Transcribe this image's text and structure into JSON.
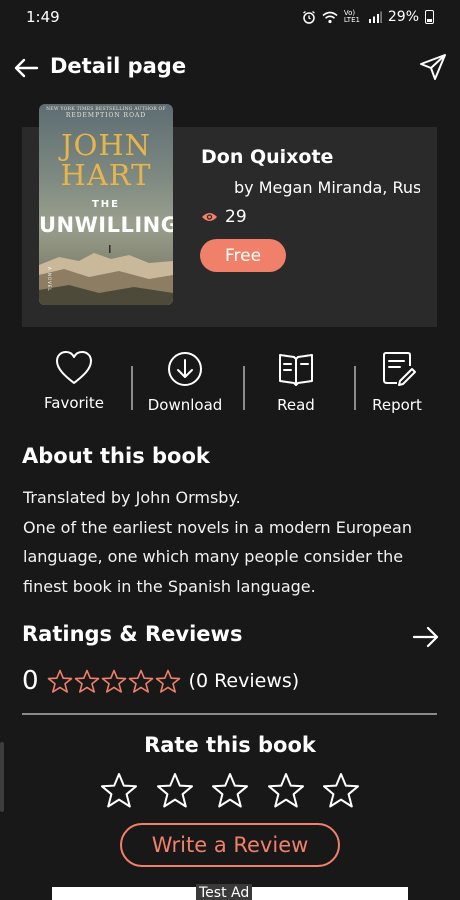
{
  "status_bar": {
    "time": "1:49",
    "network_label": "Vo) LTE1",
    "battery": "29%"
  },
  "header": {
    "title": "Detail page",
    "back_icon": "arrow-left-icon",
    "share_icon": "send-icon"
  },
  "book": {
    "cover": {
      "top_text": "NEW YORK TIMES BESTSELLING AUTHOR OF",
      "top_text_2": "REDEMPTION ROAD",
      "author_line_1": "JOHN",
      "author_line_2": "HART",
      "the": "THE",
      "title": "UNWILLING",
      "novel": "A NOVEL"
    },
    "title": "Don Quixote",
    "author": "by Megan Miranda, Rus",
    "views": "29",
    "price_label": "Free"
  },
  "actions": [
    {
      "label": "Favorite",
      "icon": "heart-icon"
    },
    {
      "label": "Download",
      "icon": "download-icon"
    },
    {
      "label": "Read",
      "icon": "book-open-icon"
    },
    {
      "label": "Report",
      "icon": "report-icon"
    }
  ],
  "about": {
    "title": "About this book",
    "lines": [
      "Translated by John Ormsby.",
      "One of the earliest novels in a modern European",
      "language, one which many people consider the",
      "finest book in the Spanish language."
    ]
  },
  "ratings": {
    "title": "Ratings & Reviews",
    "value": "0",
    "stars_filled": 0,
    "stars_total": 5,
    "review_count": "(0 Reviews)"
  },
  "rate": {
    "title": "Rate this book",
    "stars_total": 5,
    "write_review_label": "Write a Review"
  },
  "ad": {
    "label": "Test Ad"
  },
  "colors": {
    "background": "#181818",
    "card": "#2a2a2a",
    "accent": "#f0806a"
  }
}
